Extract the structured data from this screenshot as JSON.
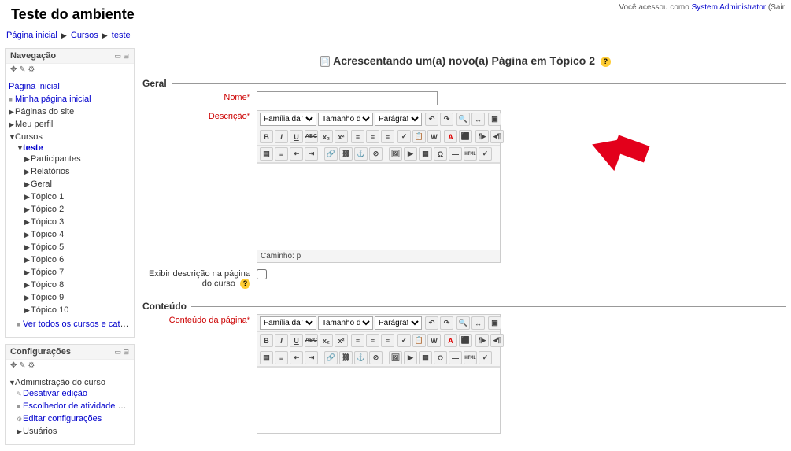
{
  "header": {
    "page_title": "Teste do ambiente",
    "login_prefix": "Você acessou como ",
    "login_user": "System Administrator",
    "login_suffix": " (Sair"
  },
  "breadcrumb": {
    "home": "Página inicial",
    "courses": "Cursos",
    "course": "teste"
  },
  "nav_block": {
    "title": "Navegação",
    "icons": "✥ ✎ ⚙",
    "home": "Página inicial",
    "myhome": "Minha página inicial",
    "sitepages": "Páginas do site",
    "myprofile": "Meu perfil",
    "courses": "Cursos",
    "course": "teste",
    "participants": "Participantes",
    "reports": "Relatórios",
    "general": "Geral",
    "topics": [
      "Tópico 1",
      "Tópico 2",
      "Tópico 3",
      "Tópico 4",
      "Tópico 5",
      "Tópico 6",
      "Tópico 7",
      "Tópico 8",
      "Tópico 9",
      "Tópico 10"
    ],
    "allcourses": "Ver todos os cursos e categorias"
  },
  "settings_block": {
    "title": "Configurações",
    "icons": "✥ ✎ ⚙",
    "courseadmin": "Administração do curso",
    "turneditoff": "Desativar edição",
    "chooseroff": "Escolhedor de atividade desligado",
    "editsettings": "Editar configurações",
    "users": "Usuários"
  },
  "main": {
    "heading": "Acrescentando um(a) novo(a) Página em Tópico 2",
    "general_legend": "Geral",
    "name_label": "Nome",
    "desc_label": "Descrição",
    "showdesc_label": "Exibir descrição na página do curso",
    "content_legend": "Conteúdo",
    "pagecontent_label": "Conteúdo da página",
    "editor": {
      "fontfamily": "Família da font",
      "fontsize": "Tamanho da fo",
      "format": "Parágrafo",
      "path_label": "Caminho: p"
    },
    "tools": {
      "undo": "↶",
      "redo": "↷",
      "find": "🔍",
      "replace": "↔",
      "fullscreen": "▣",
      "bold": "B",
      "italic": "I",
      "underline": "U",
      "strike": "ABC",
      "sub": "x₂",
      "sup": "x²",
      "removeformat": "⌫",
      "alignleft": "≡",
      "aligncenter": "≡",
      "alignright": "≡",
      "cleanup": "✓",
      "pastetext": "📋",
      "pasteword": "W",
      "forecolor": "A",
      "backcolor": "⬛",
      "ltr": "¶▸",
      "rtl": "◂¶",
      "bullist": "▤",
      "numlist": "≡",
      "outdent": "⇤",
      "indent": "⇥",
      "link": "🔗",
      "unlink": "⛓",
      "anchor": "⚓",
      "nolink": "⊘",
      "image": "🖼",
      "media": "▶",
      "table": "▦",
      "charmap": "Ω",
      "hr": "—",
      "html": "HTML",
      "spell": "✓"
    }
  }
}
